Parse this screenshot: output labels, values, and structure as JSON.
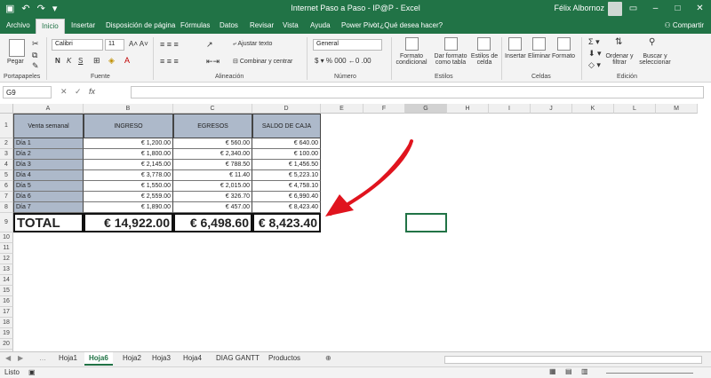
{
  "window": {
    "title": "Internet Paso a Paso - IP@P  -  Excel",
    "user": "Félix Albornoz"
  },
  "ribbon_tabs": [
    "Archivo",
    "Inicio",
    "Insertar",
    "Disposición de página",
    "Fórmulas",
    "Datos",
    "Revisar",
    "Vista",
    "Ayuda",
    "Power Pivot"
  ],
  "active_tab": "Inicio",
  "search_hint": "¿Qué desea hacer?",
  "share_label": "Compartir",
  "ribbon": {
    "paste_label": "Pegar",
    "font_name": "Calibri",
    "font_size": "11",
    "bold": "N",
    "italic": "K",
    "underline": "S",
    "wrap_text": "Ajustar texto",
    "merge_center": "Combinar y centrar",
    "number_format": "General",
    "cond_format": "Formato condicional",
    "format_table": "Dar formato como tabla",
    "cell_styles": "Estilos de celda",
    "insert": "Insertar",
    "delete": "Eliminar",
    "format": "Formato",
    "sort_filter": "Ordenar y filtrar",
    "find_select": "Buscar y seleccionar",
    "groups": [
      "Portapapeles",
      "Fuente",
      "Alineación",
      "Número",
      "Estilos",
      "Celdas",
      "Edición"
    ]
  },
  "name_box": "G9",
  "fx_label": "fx",
  "columns": [
    "A",
    "B",
    "C",
    "D",
    "E",
    "F",
    "G",
    "H",
    "I",
    "J",
    "K",
    "L",
    "M"
  ],
  "rows": [
    "1",
    "2",
    "3",
    "4",
    "5",
    "6",
    "7",
    "8",
    "9",
    "10",
    "11",
    "12",
    "13",
    "14",
    "15",
    "16",
    "17",
    "18",
    "19",
    "20",
    "21",
    "22"
  ],
  "table": {
    "headers": [
      "Venta semanal",
      "INGRESO",
      "EGRESOS",
      "SALDO DE CAJA"
    ],
    "rows": [
      [
        "Día 1",
        "€ 1,200.00",
        "€ 560.00",
        "€ 640.00"
      ],
      [
        "Día 2",
        "€ 1,800.00",
        "€ 2,340.00",
        "€ 100.00"
      ],
      [
        "Día 3",
        "€ 2,145.00",
        "€ 788.50",
        "€ 1,456.50"
      ],
      [
        "Día 4",
        "€ 3,778.00",
        "€ 11.40",
        "€ 5,223.10"
      ],
      [
        "Día 5",
        "€ 1,550.00",
        "€ 2,015.00",
        "€ 4,758.10"
      ],
      [
        "Día 6",
        "€ 2,559.00",
        "€ 326.70",
        "€ 6,990.40"
      ],
      [
        "Día 7",
        "€ 1,890.00",
        "€ 457.00",
        "€ 8,423.40"
      ]
    ],
    "total": [
      "TOTAL",
      "€ 14,922.00",
      "€ 6,498.60",
      "€ 8,423.40"
    ]
  },
  "sheet_tabs": [
    "Hoja1",
    "Hoja6",
    "Hoja2",
    "Hoja3",
    "Hoja4",
    "DIAG GANTT",
    "Productos"
  ],
  "active_sheet": "Hoja6",
  "status": "Listo",
  "colors": {
    "excel_green": "#217346",
    "header_fill": "#adb9ca",
    "arrow": "#e0141e"
  }
}
